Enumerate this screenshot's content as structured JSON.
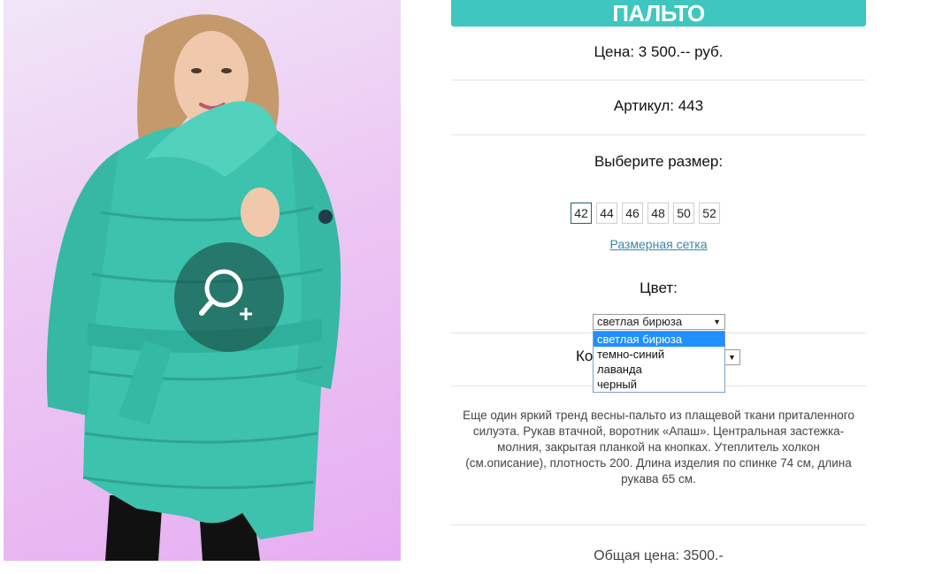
{
  "product": {
    "title": "ПАЛЬТО",
    "price": "Цена: 3 500.-- руб.",
    "sku": "Артикул: 443",
    "size_label": "Выберите размер:",
    "sizes": [
      "42",
      "44",
      "46",
      "48",
      "50",
      "52"
    ],
    "selected_size": "42",
    "size_chart_link": "Размерная сетка",
    "color_label": "Цвет:",
    "color_selected": "светлая бирюза",
    "color_options": [
      "светлая бирюза",
      "темно-синий",
      "лаванда",
      "черный"
    ],
    "quantity_label_visible": "Ко",
    "description": "Еще один яркий тренд весны-пальто из плащевой ткани приталенного силуэта. Рукав втачной, воротник «Апаш». Центральная застежка-молния, закрытая планкой на кнопках. Утеплитель холкон (см.описание), плотность 200. Длина изделия по спинке 74 см, длина рукава 65 см.",
    "total": "Общая цена: 3500.-"
  },
  "colors": {
    "title_bar": "#3ec6bf",
    "coat": "#3cc2ad",
    "link": "#3a86a8",
    "dropdown_highlight": "#1e90ff"
  },
  "icons": {
    "zoom": "magnifier-plus-icon",
    "dropdown_arrow": "triangle-down"
  }
}
